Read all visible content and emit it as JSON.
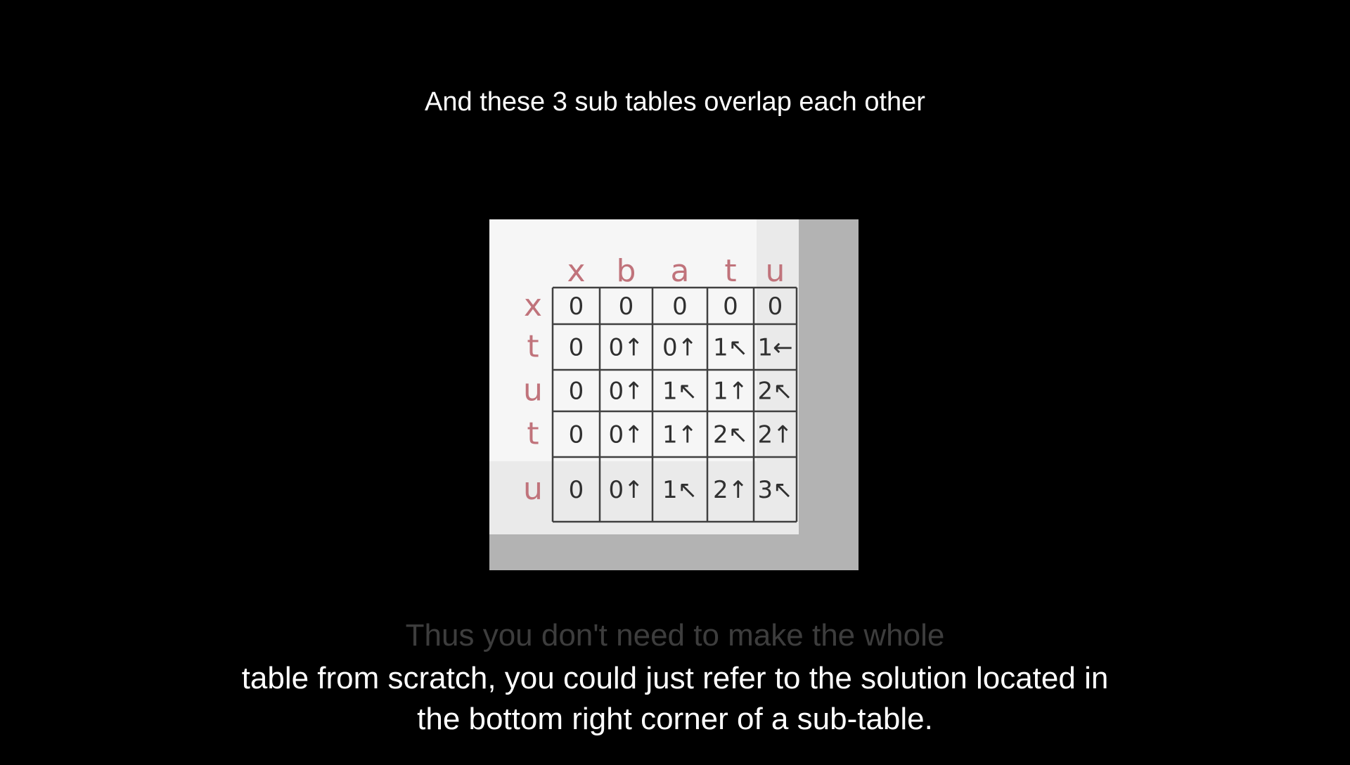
{
  "captions": {
    "top": "And these 3 sub tables overlap each other",
    "faded": "Thus you don't need to make the whole",
    "line1": "table from scratch, you could just refer to the solution located in",
    "line2": "the bottom right corner of a sub-table."
  },
  "table": {
    "column_headers": [
      "x",
      "b",
      "a",
      "t",
      "u"
    ],
    "row_headers": [
      "x",
      "t",
      "u",
      "t",
      "u"
    ],
    "rows": [
      [
        "0",
        "0",
        "0",
        "0",
        "0"
      ],
      [
        "0",
        "0↑",
        "0↑",
        "1↖",
        "1←"
      ],
      [
        "0",
        "0↑",
        "1↖",
        "1↑",
        "2↖"
      ],
      [
        "0",
        "0↑",
        "1↑",
        "2↖",
        "2↑"
      ],
      [
        "0",
        "0↑",
        "1↖",
        "2↑",
        "3↖"
      ]
    ]
  },
  "colors": {
    "background": "#000000",
    "header_ink": "#c0737b",
    "cell_ink": "#303030"
  }
}
